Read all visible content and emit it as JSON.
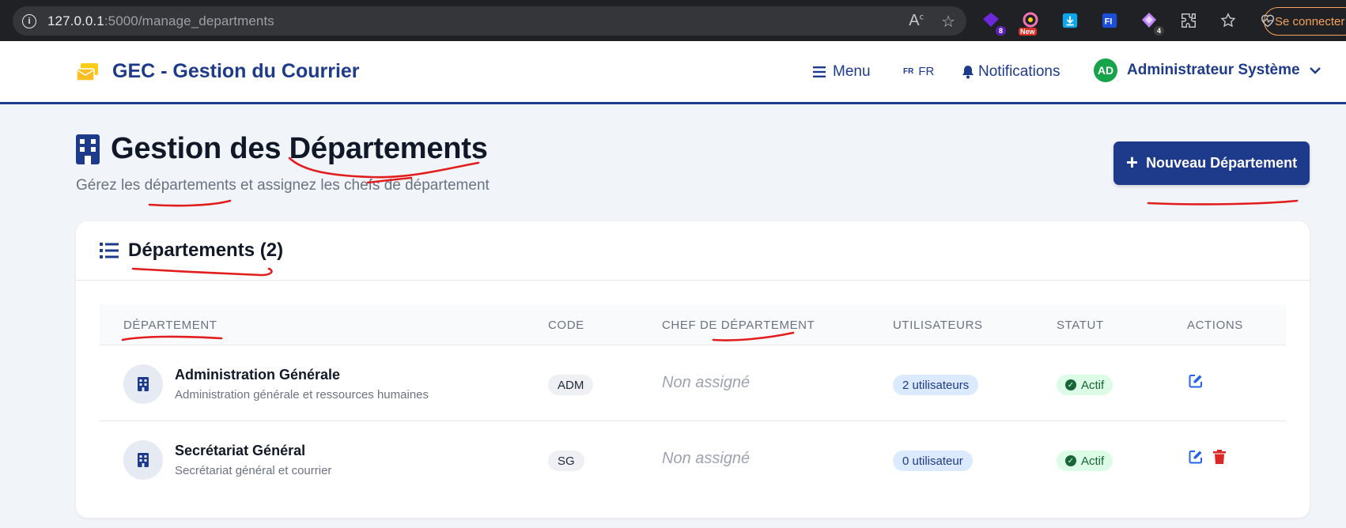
{
  "browser": {
    "url_host": "127.0.0.1",
    "url_path": ":5000/manage_departments",
    "signin_label": "Se connecter",
    "ext_badges": [
      "8",
      "New",
      "4"
    ]
  },
  "navbar": {
    "brand": "GEC - Gestion du Courrier",
    "menu_label": "Menu",
    "lang_flag": "FR",
    "lang_label": "FR",
    "notifications_label": "Notifications",
    "user_initials": "AD",
    "user_name": "Administrateur Système"
  },
  "page": {
    "title": "Gestion des Départements",
    "subtitle": "Gérez les départements et assignez les chefs de département",
    "new_button_label": "Nouveau Département"
  },
  "card": {
    "title": "Départements (2)"
  },
  "table": {
    "headers": {
      "department": "DÉPARTEMENT",
      "code": "CODE",
      "chef": "CHEF DE DÉPARTEMENT",
      "users": "UTILISATEURS",
      "status": "STATUT",
      "actions": "ACTIONS"
    },
    "rows": [
      {
        "name": "Administration Générale",
        "description": "Administration générale et ressources humaines",
        "code": "ADM",
        "chef": "Non assigné",
        "users": "2 utilisateurs",
        "status": "Actif"
      },
      {
        "name": "Secrétariat Général",
        "description": "Secrétariat général et courrier",
        "code": "SG",
        "chef": "Non assigné",
        "users": "0 utilisateur",
        "status": "Actif"
      }
    ]
  },
  "colors": {
    "primary": "#1e3a8a",
    "annotation": "#e11d1d",
    "status_green": "#166534",
    "delete_red": "#dc2626"
  }
}
